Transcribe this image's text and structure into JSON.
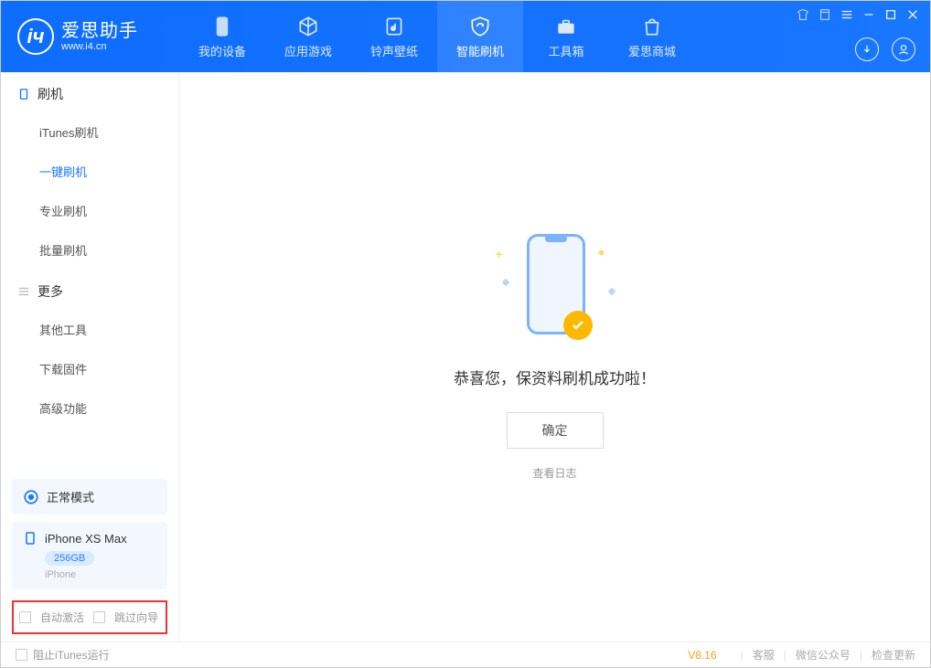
{
  "app": {
    "title": "爱思助手",
    "subtitle": "www.i4.cn"
  },
  "nav": {
    "items": [
      {
        "label": "我的设备"
      },
      {
        "label": "应用游戏"
      },
      {
        "label": "铃声壁纸"
      },
      {
        "label": "智能刷机"
      },
      {
        "label": "工具箱"
      },
      {
        "label": "爱思商城"
      }
    ],
    "active_index": 3
  },
  "sidebar": {
    "section1": {
      "title": "刷机",
      "items": [
        {
          "label": "iTunes刷机"
        },
        {
          "label": "一键刷机"
        },
        {
          "label": "专业刷机"
        },
        {
          "label": "批量刷机"
        }
      ],
      "active_index": 1
    },
    "section2": {
      "title": "更多",
      "items": [
        {
          "label": "其他工具"
        },
        {
          "label": "下载固件"
        },
        {
          "label": "高级功能"
        }
      ]
    },
    "mode": {
      "label": "正常模式"
    },
    "device": {
      "name": "iPhone XS Max",
      "capacity": "256GB",
      "type": "iPhone"
    },
    "options": {
      "auto_activate": "自动激活",
      "skip_guide": "跳过向导"
    }
  },
  "main": {
    "message": "恭喜您，保资料刷机成功啦！",
    "ok_label": "确定",
    "log_label": "查看日志"
  },
  "footer": {
    "block_itunes": "阻止iTunes运行",
    "version": "V8.16",
    "links": {
      "support": "客服",
      "wechat": "微信公众号",
      "update": "检查更新"
    }
  }
}
